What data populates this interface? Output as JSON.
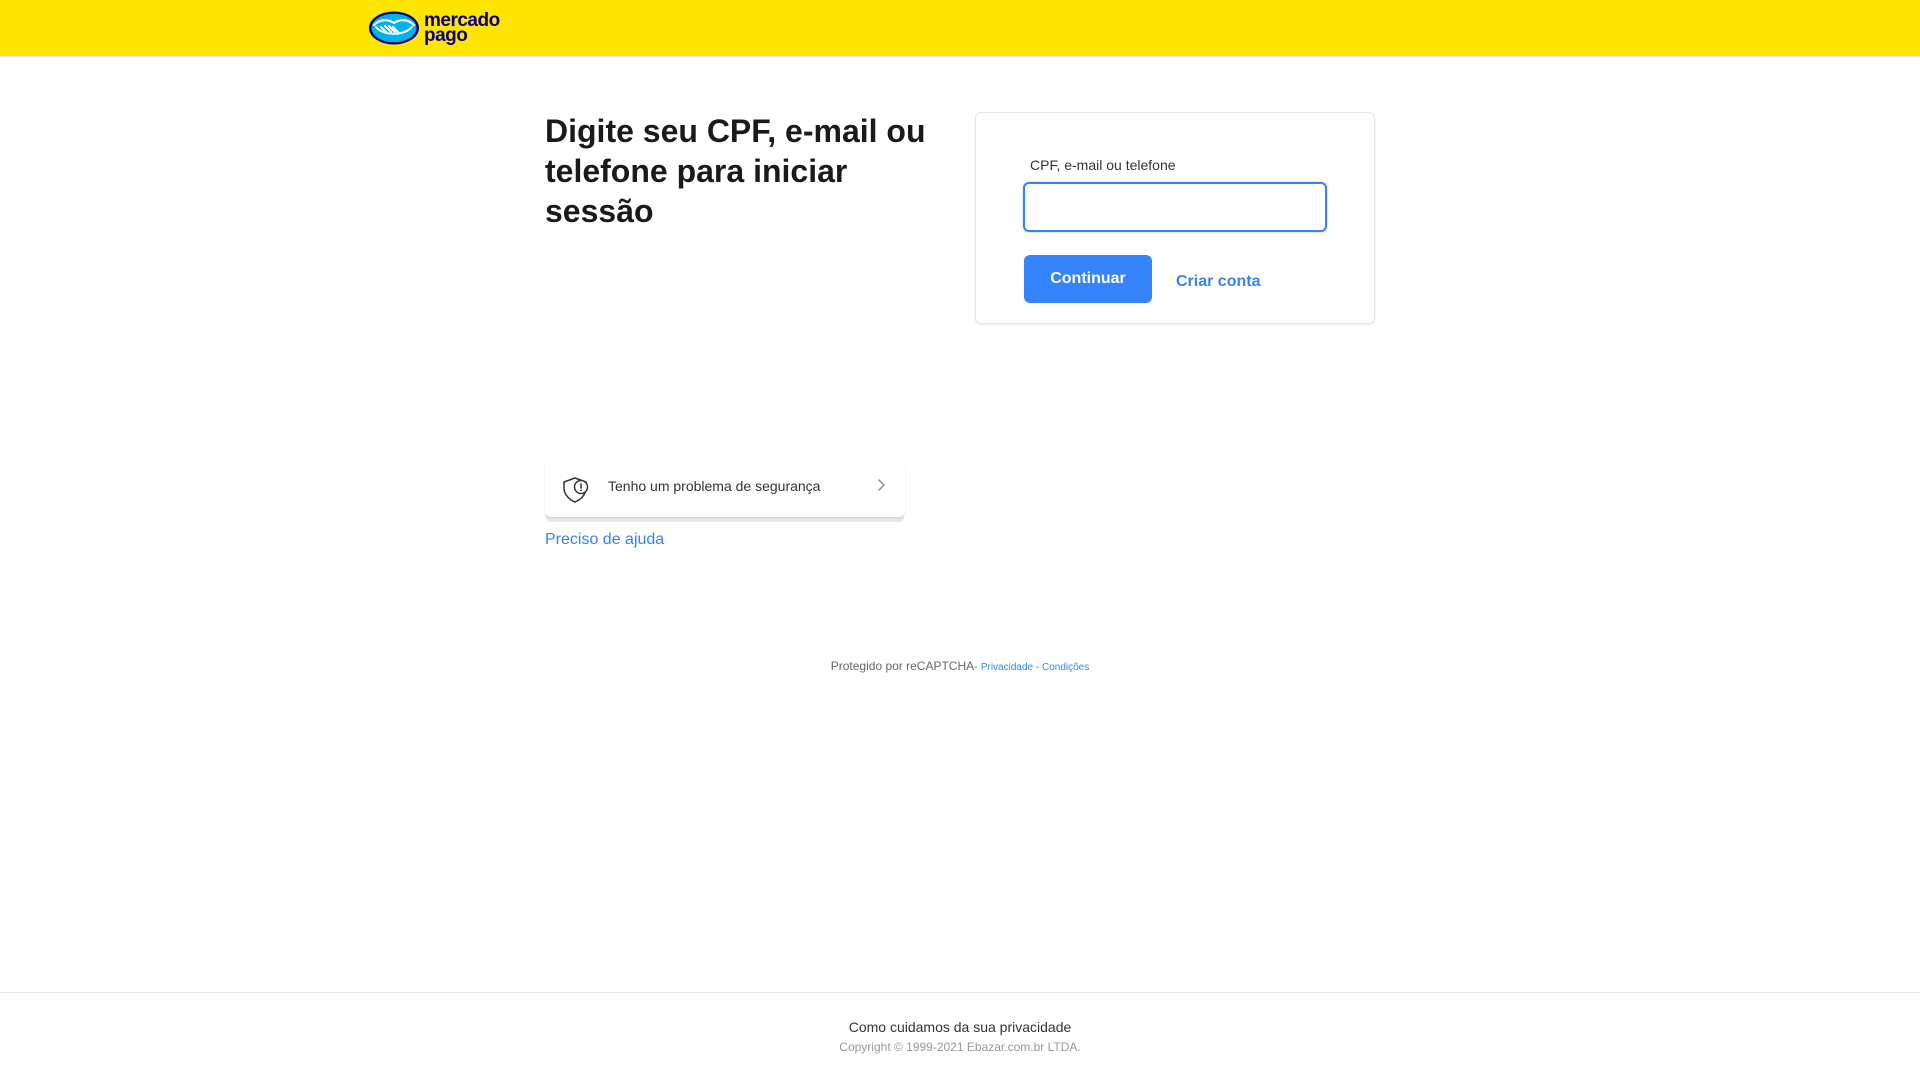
{
  "header": {
    "logo": {
      "icon": "handshake-icon",
      "line1": "mercado",
      "line2": "pago"
    }
  },
  "main": {
    "title": "Digite seu CPF, e-mail ou telefone para iniciar sessão",
    "security_card": {
      "icon": "shield-alert-icon",
      "label": "Tenho um problema de segurança",
      "chevron_icon": "chevron-right-icon"
    },
    "help_link": "Preciso de ajuda"
  },
  "login_card": {
    "field_label": "CPF, e-mail ou telefone",
    "field_value": "",
    "continue_label": "Continuar",
    "create_account_label": "Criar conta"
  },
  "recaptcha": {
    "text": "Protegido por reCAPTCHA",
    "separator": "-",
    "privacy_link": "Privacidade",
    "dash": " - ",
    "terms_link": "Condições"
  },
  "footer": {
    "privacy_link": "Como cuidamos da sua privacidade",
    "copyright": "Copyright © 1999-2021 Ebazar.com.br LTDA."
  },
  "colors": {
    "header_bg": "#ffe600",
    "primary_blue": "#3483fa",
    "logo_navy": "#0a0080"
  }
}
